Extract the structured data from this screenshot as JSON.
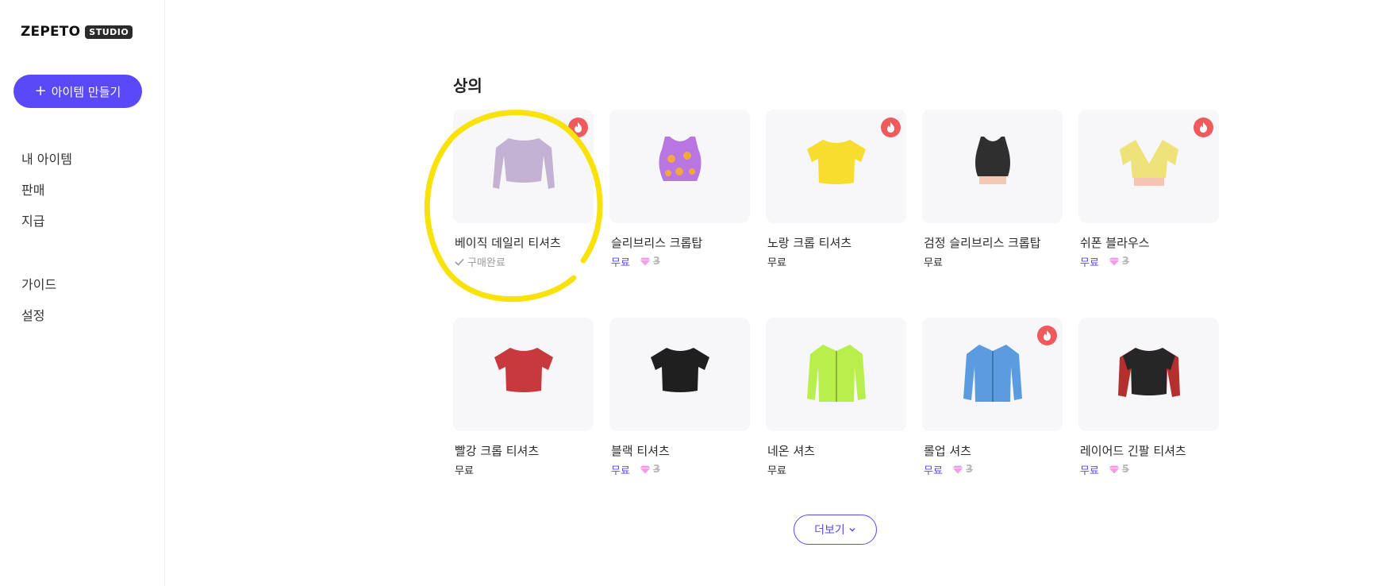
{
  "brand": {
    "name": "ZEPETO",
    "badge": "STUDIO"
  },
  "sidebar": {
    "create_button": {
      "icon": "plus-icon",
      "label": "아이템 만들기"
    },
    "nav": [
      {
        "label": "내 아이템"
      },
      {
        "label": "판매"
      },
      {
        "label": "지급"
      },
      {
        "label": "가이드"
      },
      {
        "label": "설정"
      }
    ]
  },
  "section": {
    "title": "상의"
  },
  "colors": {
    "accent": "#5a49f8",
    "hot_badge": "#ef5a5d",
    "annotation": "#f8e20a"
  },
  "items": [
    {
      "name": "베이직 데일리 티셔츠",
      "status": "구매완료",
      "owned": true,
      "hot": true,
      "color": "#c3b2d3"
    },
    {
      "name": "슬리브리스 크롭탑",
      "price": "무료",
      "old_price": "3",
      "hot": false,
      "color": "#b976e0"
    },
    {
      "name": "노랑 크롭 티셔츠",
      "price": "무료",
      "hot": true,
      "color": "#f6dd2e"
    },
    {
      "name": "검정 슬리브리스 크롭탑",
      "price": "무료",
      "hot": false,
      "color": "#2f2f2f"
    },
    {
      "name": "쉬폰 블라우스",
      "price": "무료",
      "old_price": "3",
      "hot": true,
      "color": "#eee27a"
    },
    {
      "name": "빨강 크롭 티셔츠",
      "price": "무료",
      "hot": false,
      "color": "#c7393d"
    },
    {
      "name": "블랙 티셔츠",
      "price": "무료",
      "old_price": "3",
      "hot": false,
      "color": "#1f1f1f"
    },
    {
      "name": "네온 셔츠",
      "price": "무료",
      "hot": false,
      "color": "#b9ef4a"
    },
    {
      "name": "롤업 셔츠",
      "price": "무료",
      "old_price": "3",
      "hot": true,
      "color": "#5b9ce0"
    },
    {
      "name": "레이어드 긴팔 티셔츠",
      "price": "무료",
      "old_price": "5",
      "hot": false,
      "color": "#262626"
    }
  ],
  "more_button": {
    "label": "더보기",
    "icon": "chevron-down-icon"
  }
}
